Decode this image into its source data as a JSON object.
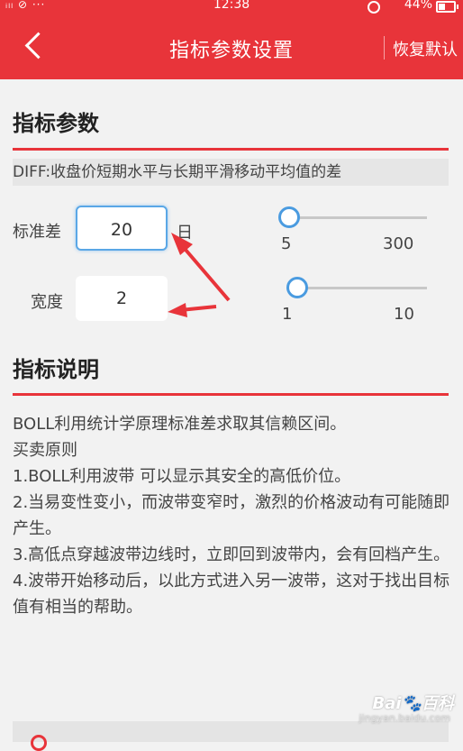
{
  "status_bar": {
    "left": "ᵢₗₗ ⊘ ···",
    "time": "12:38",
    "battery": "44%"
  },
  "header": {
    "title": "指标参数设置",
    "restore_label": "恢复默认"
  },
  "params_section": {
    "title": "指标参数",
    "description": "DIFF:收盘价短期水平与长期平滑移动平均值的差",
    "params": [
      {
        "label": "标准差",
        "value": "20",
        "unit": "日",
        "slider_min": "5",
        "slider_max": "300",
        "slider_position": 0.0
      },
      {
        "label": "宽度",
        "value": "2",
        "unit": "",
        "slider_min": "1",
        "slider_max": "10",
        "slider_position": 0.05
      }
    ]
  },
  "explain_section": {
    "title": "指标说明",
    "lines": [
      "BOLL利用统计学原理标准差求取其信赖区间。",
      "买卖原则",
      "1.BOLL利用波带 可以显示其安全的高低价位。",
      "2.当易变性变小，而波带变窄时，激烈的价格波动有可能随即产生。",
      "3.高低点穿越波带边线时，立即回到波带内，会有回档产生。",
      "4.波带开始移动后，以此方式进入另一波带，这对于找出目标值有相当的帮助。"
    ]
  },
  "watermark": {
    "text": "Bai🐾百科",
    "sub": "jingyan.baidu.com"
  },
  "colors": {
    "brand_red": "#e8343a",
    "slider_blue": "#4a9be0"
  }
}
